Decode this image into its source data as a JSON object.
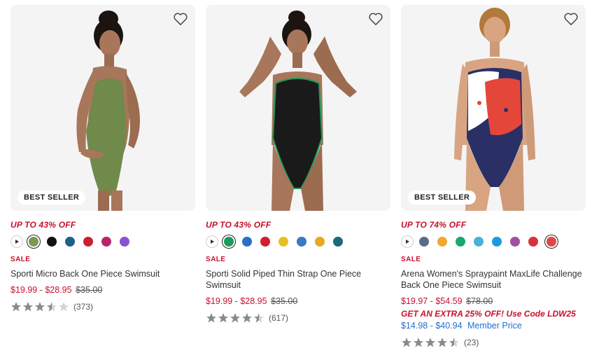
{
  "colors": {
    "sale_red": "#c8102e",
    "member_blue": "#1f6fd0",
    "star_gray": "#8a8a8a",
    "star_empty": "#d4d4d4"
  },
  "products": [
    {
      "badge": "BEST SELLER",
      "promo": "UP TO 43% OFF",
      "sale_label": "SALE",
      "title": "Sporti Micro Back One Piece Swimsuit",
      "price_range": "$19.99 - $28.95",
      "original_price": "$35.00",
      "rating": 3.5,
      "review_count": "(373)",
      "swatches": [
        "#7a9a52",
        "#111111",
        "#1f5f8b",
        "#c8202f",
        "#b8246a",
        "#8a52d0"
      ],
      "selected_swatch": 0
    },
    {
      "badge": "",
      "promo": "UP TO 43% OFF",
      "sale_label": "SALE",
      "title": "Sporti Solid Piped Thin Strap One Piece Swimsuit",
      "price_range": "$19.99 - $28.95",
      "original_price": "$35.00",
      "rating": 4.5,
      "review_count": "(617)",
      "swatches": [
        "#1d9a5b",
        "#2a6ec9",
        "#d01f2f",
        "#e6c020",
        "#3a78c0",
        "#e8a820",
        "#1a6a7a"
      ],
      "selected_swatch": 0
    },
    {
      "badge": "BEST SELLER",
      "promo": "UP TO 74% OFF",
      "sale_label": "SALE",
      "title": "Arena Women's Spraypaint MaxLife Challenge Back One Piece Swimsuit",
      "price_range": "$19.97 - $54.59",
      "original_price": "$78.00",
      "extra_promo": "GET AN EXTRA 25% OFF! Use Code LDW25",
      "member_price": "$14.98 - $40.94",
      "member_label": "Member Price",
      "rating": 4.5,
      "review_count": "(23)",
      "swatches": [
        "#5a6b8a",
        "#f0a830",
        "#1aa870",
        "#4ab0d8",
        "#1e9ae0",
        "#a050a0",
        "#d8303a",
        "#e04848"
      ],
      "selected_swatch": 7
    }
  ]
}
